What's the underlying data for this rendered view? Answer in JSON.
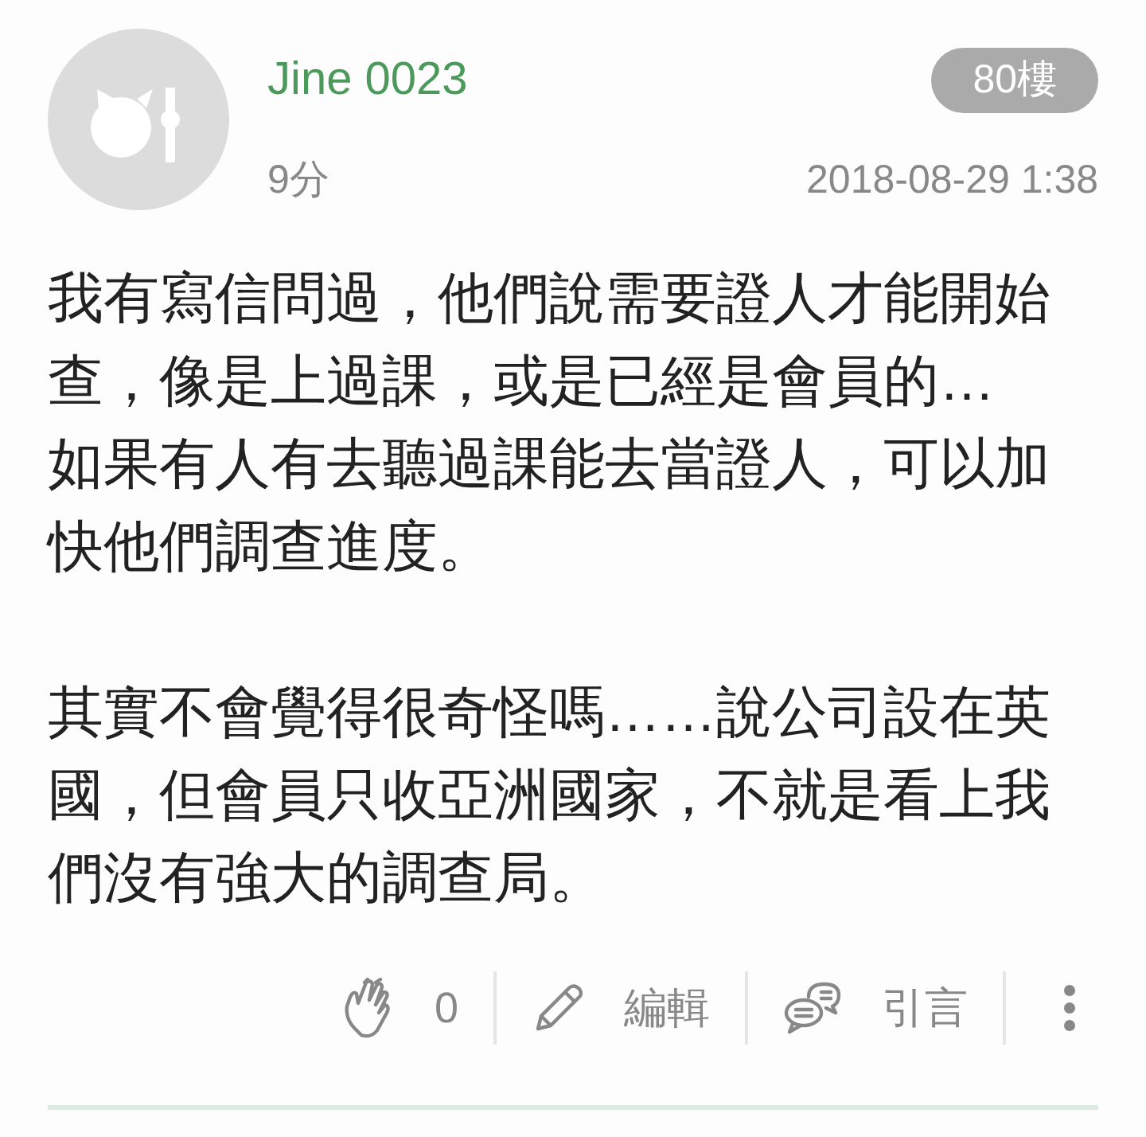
{
  "post": {
    "author": "Jine 0023",
    "score": "9分",
    "floor": "80樓",
    "date": "2018-08-29 1:38",
    "paragraphs": [
      [
        "我有寫信問過，他們說需要證人才能開始查，像是上過課，或是已經是會員的…",
        "如果有人有去聽過課能去當證人，可以加快他們調查進度。"
      ],
      [
        "其實不會覺得很奇怪嗎……說公司設在英國，但會員只收亞洲國家，不就是看上我們沒有強大的調查局。"
      ]
    ],
    "actions": [
      {
        "kind": "clap",
        "label": "0"
      },
      {
        "kind": "edit",
        "label": "編輯"
      },
      {
        "kind": "quote",
        "label": "引言"
      },
      {
        "kind": "more"
      }
    ]
  }
}
